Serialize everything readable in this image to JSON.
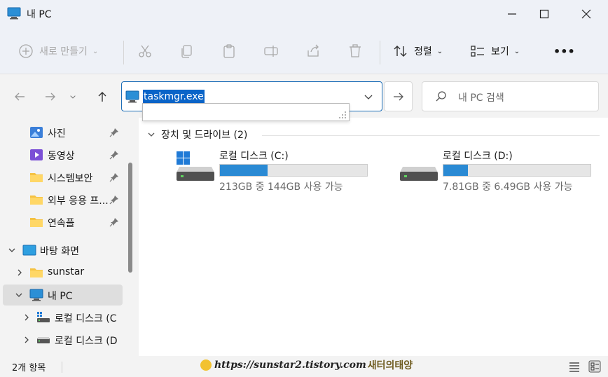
{
  "window": {
    "title": "내 PC"
  },
  "commandbar": {
    "new_label": "새로 만들기",
    "sort_label": "정렬",
    "view_label": "보기",
    "more_label": "•••"
  },
  "address": {
    "value": "taskmgr.exe"
  },
  "search": {
    "placeholder": "내 PC 검색"
  },
  "sidebar": {
    "pinned": [
      {
        "label": "사진"
      },
      {
        "label": "동영상"
      },
      {
        "label": "시스템보안"
      },
      {
        "label": "외부 응용 프..."
      },
      {
        "label": "연속플"
      }
    ],
    "tree": [
      {
        "label": "바탕 화면"
      },
      {
        "label": "sunstar"
      },
      {
        "label": "내 PC"
      },
      {
        "label": "로컬 디스크 (C"
      },
      {
        "label": "로컬 디스크 (D"
      }
    ]
  },
  "content": {
    "group_header": "장치 및 드라이브 (2)",
    "drives": [
      {
        "name": "로컬 디스크 (C:)",
        "info": "213GB 중 144GB 사용 가능",
        "used_fraction": 0.324
      },
      {
        "name": "로컬 디스크 (D:)",
        "info": "7.81GB 중 6.49GB 사용 가능",
        "used_fraction": 0.169
      }
    ]
  },
  "status": {
    "count": "2개 항목",
    "watermark_url": "https://sunstar2.tistory.com",
    "watermark_name": "새터의태양"
  },
  "colors": {
    "accent": "#1f6fb8",
    "drive_fill": "#2a8ad4",
    "selection": "#0a64c8"
  }
}
